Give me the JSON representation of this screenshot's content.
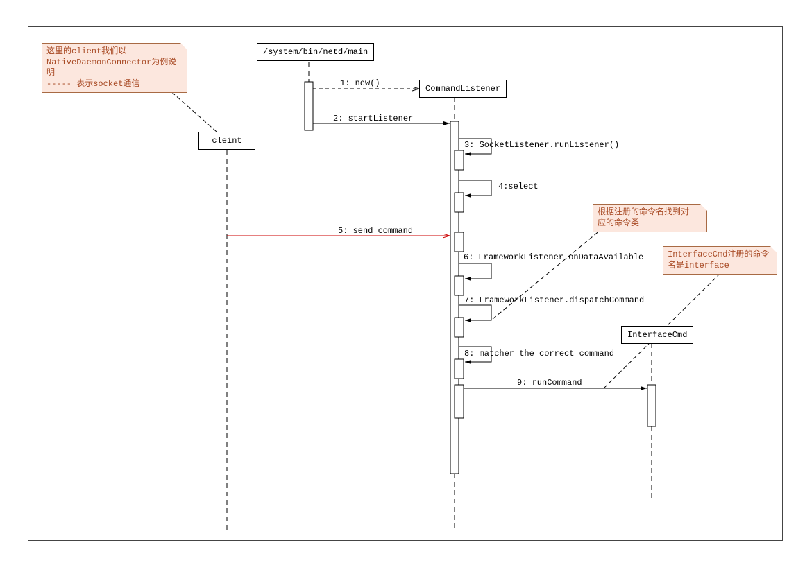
{
  "notes": {
    "note1_line1": "这里的client我们以",
    "note1_line2": "NativeDaemonConnector为例说明",
    "note1_line3": "-----   表示socket通信",
    "note2_line1": "根据注册的命令名找到对",
    "note2_line2": "应的命令类",
    "note3_line1": "InterfaceCmd注册的命令",
    "note3_line2": "名是interface"
  },
  "participants": {
    "client": "cleint",
    "main": "/system/bin/netd/main",
    "cmdListener": "CommandListener",
    "ifaceCmd": "InterfaceCmd"
  },
  "messages": {
    "m1": "1:  new()",
    "m2": "2:  startListener",
    "m3": "3:  SocketListener.runListener()",
    "m4": "4:select",
    "m5": "5:  send command",
    "m6": "6:  FrameworkListener.onDataAvailable",
    "m7": "7:  FrameworkListener.dispatchCommand",
    "m8": "8: matcher the correct command",
    "m9": "9:  runCommand"
  },
  "chart_data": {
    "type": "sequence-diagram",
    "participants": [
      {
        "id": "client",
        "label": "cleint"
      },
      {
        "id": "main",
        "label": "/system/bin/netd/main"
      },
      {
        "id": "cmdListener",
        "label": "CommandListener"
      },
      {
        "id": "ifaceCmd",
        "label": "InterfaceCmd"
      }
    ],
    "messages": [
      {
        "n": 1,
        "from": "main",
        "to": "cmdListener",
        "label": "new()",
        "type": "create"
      },
      {
        "n": 2,
        "from": "main",
        "to": "cmdListener",
        "label": "startListener",
        "type": "sync"
      },
      {
        "n": 3,
        "from": "cmdListener",
        "to": "cmdListener",
        "label": "SocketListener.runListener()",
        "type": "self"
      },
      {
        "n": 4,
        "from": "cmdListener",
        "to": "cmdListener",
        "label": "select",
        "type": "self"
      },
      {
        "n": 5,
        "from": "client",
        "to": "cmdListener",
        "label": "send command",
        "type": "socket",
        "color": "#c00"
      },
      {
        "n": 6,
        "from": "cmdListener",
        "to": "cmdListener",
        "label": "FrameworkListener.onDataAvailable",
        "type": "self"
      },
      {
        "n": 7,
        "from": "cmdListener",
        "to": "cmdListener",
        "label": "FrameworkListener.dispatchCommand",
        "type": "self"
      },
      {
        "n": 8,
        "from": "cmdListener",
        "to": "cmdListener",
        "label": "matcher the correct command",
        "type": "self"
      },
      {
        "n": 9,
        "from": "cmdListener",
        "to": "ifaceCmd",
        "label": "runCommand",
        "type": "sync"
      }
    ],
    "notes": [
      {
        "attached_to": "client",
        "text": "这里的client我们以 NativeDaemonConnector为例说明 ----- 表示socket通信"
      },
      {
        "attached_to": "message7",
        "text": "根据注册的命令名找到对应的命令类"
      },
      {
        "attached_to": "message9",
        "text": "InterfaceCmd注册的命令名是interface"
      }
    ]
  }
}
